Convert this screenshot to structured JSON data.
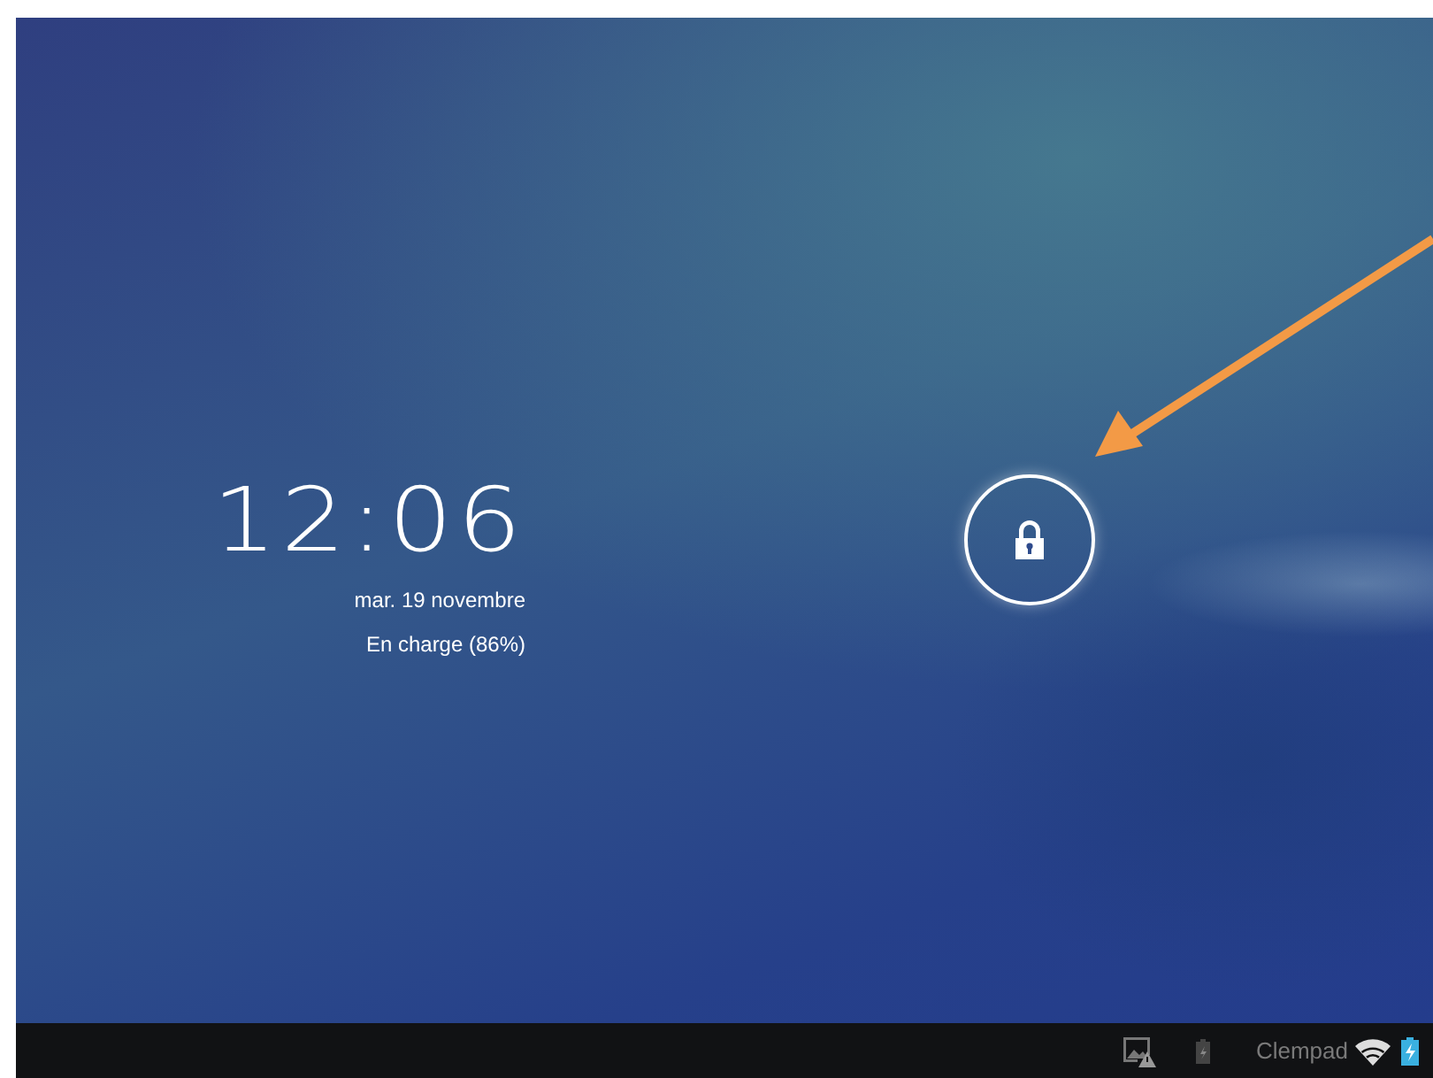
{
  "lock_screen": {
    "time": "12:06",
    "date": "mar. 19 novembre",
    "charging_status": "En charge (86%)"
  },
  "status_bar": {
    "network_name": "Clempad"
  }
}
